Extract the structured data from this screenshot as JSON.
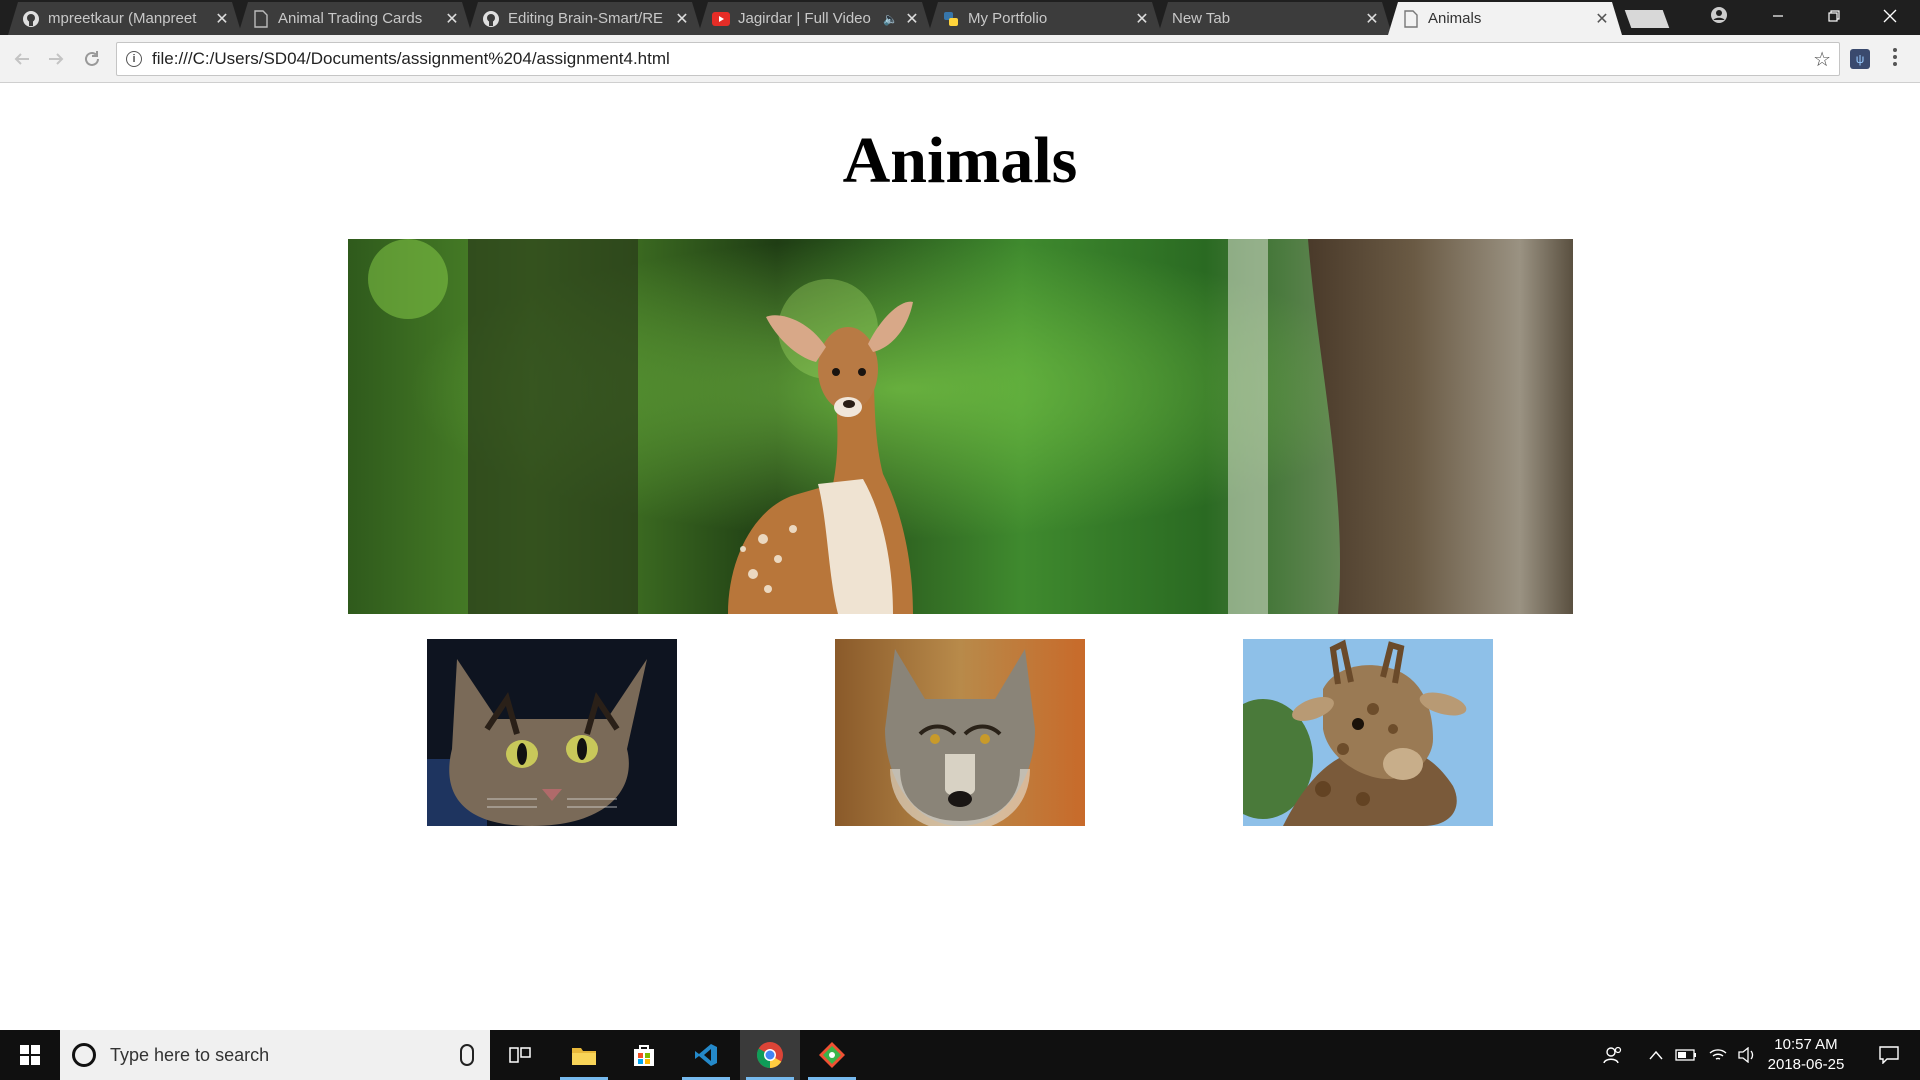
{
  "browser": {
    "tabs": [
      {
        "label": "mpreetkaur (Manpreet",
        "icon": "github-icon"
      },
      {
        "label": "Animal Trading Cards",
        "icon": "page-icon"
      },
      {
        "label": "Editing Brain-Smart/RE",
        "icon": "github-icon"
      },
      {
        "label": "Jagirdar | Full Video",
        "icon": "youtube-icon",
        "audio": "🔈"
      },
      {
        "label": "My Portfolio",
        "icon": "python-icon"
      },
      {
        "label": "New Tab",
        "icon": ""
      },
      {
        "label": "Animals",
        "icon": "page-icon",
        "active": true
      }
    ],
    "close_glyph": "✕",
    "url": "file:///C:/Users/SD04/Documents/assignment%204/assignment4.html",
    "ext_label": "ψ"
  },
  "page": {
    "title": "Animals",
    "hero_image": "deer-fawn-photo",
    "thumbnails": [
      "cat-photo",
      "wolf-photo",
      "giraffe-photo"
    ]
  },
  "taskbar": {
    "search_placeholder": "Type here to search",
    "apps": [
      "task-view-icon",
      "file-explorer-icon",
      "store-icon",
      "vscode-icon",
      "chrome-icon",
      "git-icon"
    ],
    "time": "10:57 AM",
    "date": "2018-06-25"
  },
  "colors": {
    "titlebar": "#1f1f1f",
    "tab_inactive": "#3c3c3c",
    "tab_active": "#f2f2f2",
    "taskbar": "#101010",
    "accent": "#76b9ed"
  }
}
